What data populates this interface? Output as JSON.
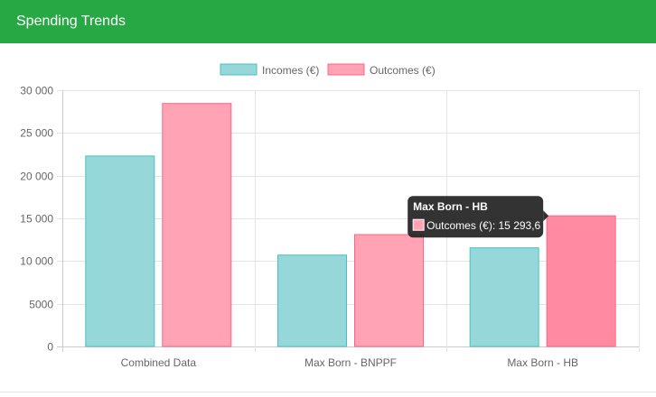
{
  "header": {
    "title": "Spending Trends"
  },
  "colors": {
    "header_bg": "#28a745",
    "incomes_fill": "#96d8da",
    "incomes_border": "#4bc0c0",
    "outcomes_fill": "#ffa3b5",
    "outcomes_border": "#ff6384",
    "outcomes_hover_fill": "#ff8aa2",
    "grid": "#e5e5e5",
    "tick_text": "#666666",
    "tooltip_bg": "#222222"
  },
  "chart_data": {
    "type": "bar",
    "categories": [
      "Combined Data",
      "Max Born - BNPPF",
      "Max Born - HB"
    ],
    "series": [
      {
        "name": "Incomes (€)",
        "values": [
          22300,
          10700,
          11550
        ]
      },
      {
        "name": "Outcomes (€)",
        "values": [
          28450,
          13100,
          15293.6
        ]
      }
    ],
    "ylim": [
      0,
      30000
    ],
    "yticks": [
      0,
      5000,
      10000,
      15000,
      20000,
      25000,
      30000
    ],
    "ytick_labels": [
      "0",
      "5000",
      "10 000",
      "15 000",
      "20 000",
      "25 000",
      "30 000"
    ],
    "legend_position": "top",
    "grid": true,
    "tooltip": {
      "title": "Max Born - HB",
      "label": "Outcomes (€): 15 293,6",
      "series_index": 1,
      "category_index": 2
    }
  }
}
